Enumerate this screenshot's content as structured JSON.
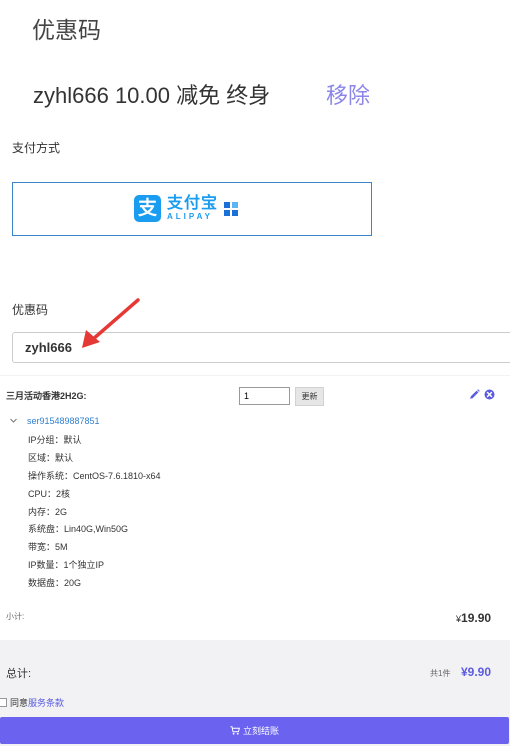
{
  "coupon": {
    "title": "优惠码",
    "applied": "zyhl666 10.00 减免 终身",
    "remove_label": "移除"
  },
  "payment": {
    "label": "支付方式",
    "alipay_cn": "支付宝",
    "alipay_en": "ALIPAY",
    "alipay_mark": "支"
  },
  "coupon_form": {
    "label": "优惠码",
    "value": "zyhl666"
  },
  "order": {
    "product_name": "三月活动香港2H2G:",
    "quantity": "1",
    "update_label": "更新",
    "server_name": "ser915489887851",
    "specs": [
      "IP分组：默认",
      "区域：默认",
      "操作系统：CentOS-7.6.1810-x64",
      "CPU：2核",
      "内存：2G",
      "系统盘：Lin40G,Win50G",
      "带宽：5M",
      "IP数量：1个独立IP",
      "数据盘：20G"
    ],
    "subtotal_label": "小计:",
    "subtotal_currency": "¥",
    "subtotal_value": "19.90"
  },
  "summary": {
    "total_label": "总计:",
    "count": "共1件",
    "total_value": "¥9.90",
    "agree_prefix": "同意",
    "terms_label": "服务条款",
    "checkout_label": "立刻结账"
  },
  "colors": {
    "accent": "#6b63f0",
    "remove": "#8b86e8",
    "alipay": "#1a9df1",
    "link": "#2f7fd0",
    "arrow": "#e53935"
  },
  "icons": [
    "alipay-logo-icon",
    "arrow-annotation-icon",
    "pencil-icon",
    "close-circle-icon",
    "chevron-down-icon",
    "cart-icon"
  ]
}
